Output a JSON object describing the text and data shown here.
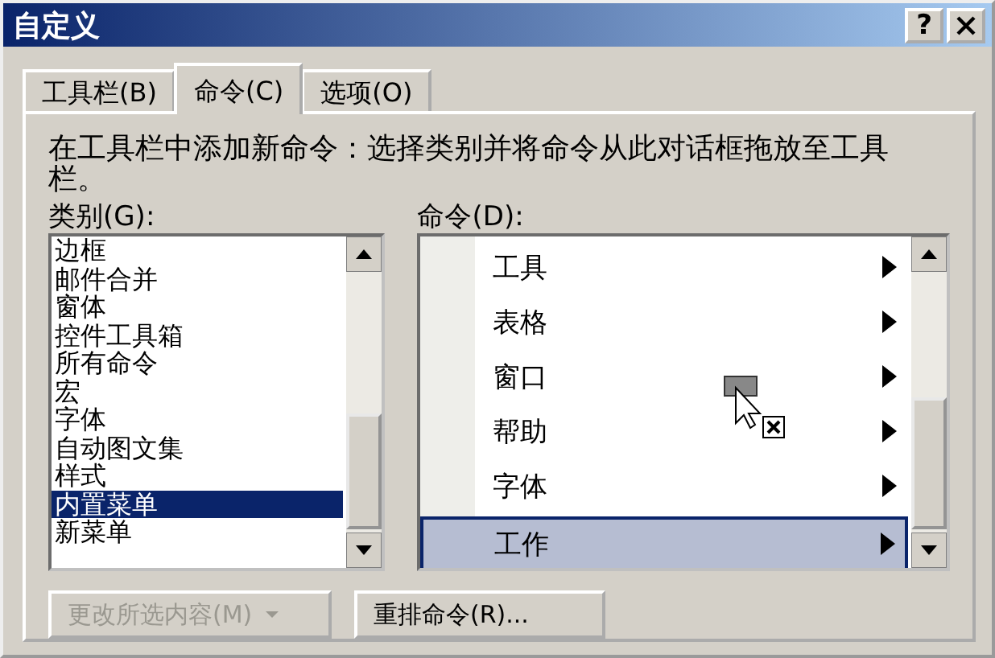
{
  "window": {
    "title": "自定义",
    "help_button": "?"
  },
  "tabs": [
    {
      "label": "工具栏(B)",
      "selected": false
    },
    {
      "label": "命令(C)",
      "selected": true
    },
    {
      "label": "选项(O)",
      "selected": false
    }
  ],
  "description": "在工具栏中添加新命令：选择类别并将命令从此对话框拖放至工具栏。",
  "categories": {
    "label": "类别(G):",
    "items": [
      {
        "label": "边框",
        "selected": false
      },
      {
        "label": "邮件合并",
        "selected": false
      },
      {
        "label": "窗体",
        "selected": false
      },
      {
        "label": "控件工具箱",
        "selected": false
      },
      {
        "label": "所有命令",
        "selected": false
      },
      {
        "label": "宏",
        "selected": false
      },
      {
        "label": "字体",
        "selected": false
      },
      {
        "label": "自动图文集",
        "selected": false
      },
      {
        "label": "样式",
        "selected": false
      },
      {
        "label": "内置菜单",
        "selected": true
      },
      {
        "label": "新菜单",
        "selected": false
      }
    ]
  },
  "commands": {
    "label": "命令(D):",
    "items": [
      {
        "label": "工具",
        "selected": false,
        "submenu": true
      },
      {
        "label": "表格",
        "selected": false,
        "submenu": true
      },
      {
        "label": "窗口",
        "selected": false,
        "submenu": true
      },
      {
        "label": "帮助",
        "selected": false,
        "submenu": true
      },
      {
        "label": "字体",
        "selected": false,
        "submenu": true
      },
      {
        "label": "工作",
        "selected": true,
        "submenu": true
      }
    ]
  },
  "buttons": [
    {
      "label": "更改所选内容(M)",
      "disabled": true,
      "dropdown": true
    },
    {
      "label": "重排命令(R)...",
      "disabled": false,
      "dropdown": false
    }
  ]
}
